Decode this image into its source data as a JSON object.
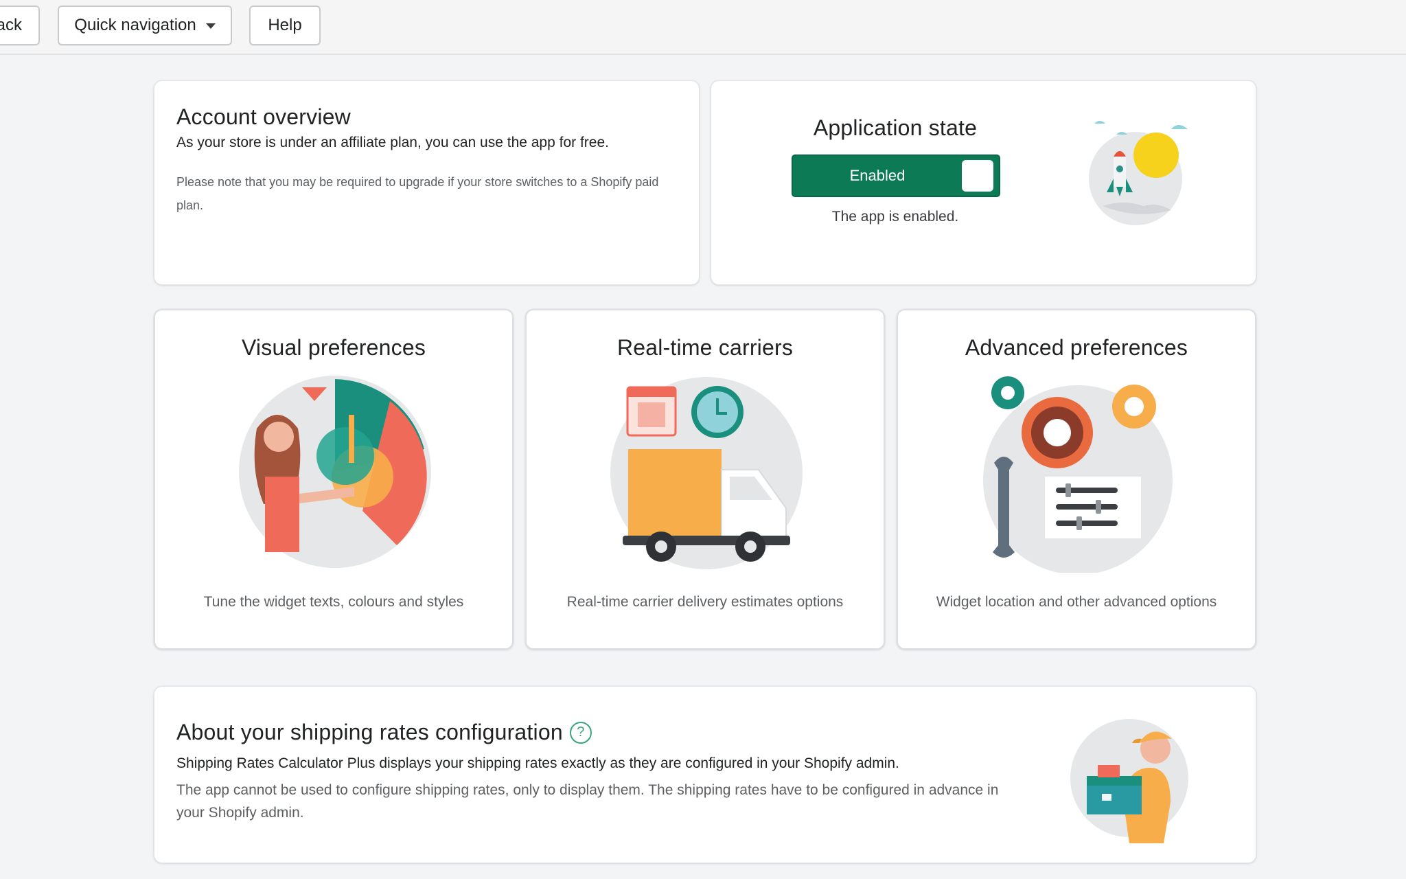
{
  "topbar": {
    "back_label": "ack",
    "quick_nav_label": "Quick navigation",
    "help_label": "Help"
  },
  "account": {
    "title": "Account overview",
    "main": "As your store is under an affiliate plan, you can use the app for free.",
    "note": "Please note that you may be required to upgrade if your store switches to a Shopify paid plan."
  },
  "app_state": {
    "title": "Application state",
    "toggle_label": "Enabled",
    "toggle_on": true,
    "status": "The app is enabled."
  },
  "tiles": [
    {
      "title": "Visual preferences",
      "desc": "Tune the widget texts, colours and styles",
      "icon": "designer-palette-icon"
    },
    {
      "title": "Real-time carriers",
      "desc": "Real-time carrier delivery estimates options",
      "icon": "delivery-truck-icon"
    },
    {
      "title": "Advanced preferences",
      "desc": "Widget location and other advanced options",
      "icon": "gears-wrench-icon"
    }
  ],
  "about": {
    "title": "About your shipping rates configuration",
    "help_icon": "question-circle-icon",
    "main": "Shipping Rates Calculator Plus displays your shipping rates exactly as they are configured in your Shopify admin.",
    "sub": "The app cannot be used to configure shipping rates, only to display them. The shipping rates have to be configured in advance in your Shopify admin."
  },
  "colors": {
    "accent_green": "#0d7a56",
    "teal": "#1a8f7d",
    "orange": "#f7ad4a",
    "background": "#f3f4f5"
  }
}
